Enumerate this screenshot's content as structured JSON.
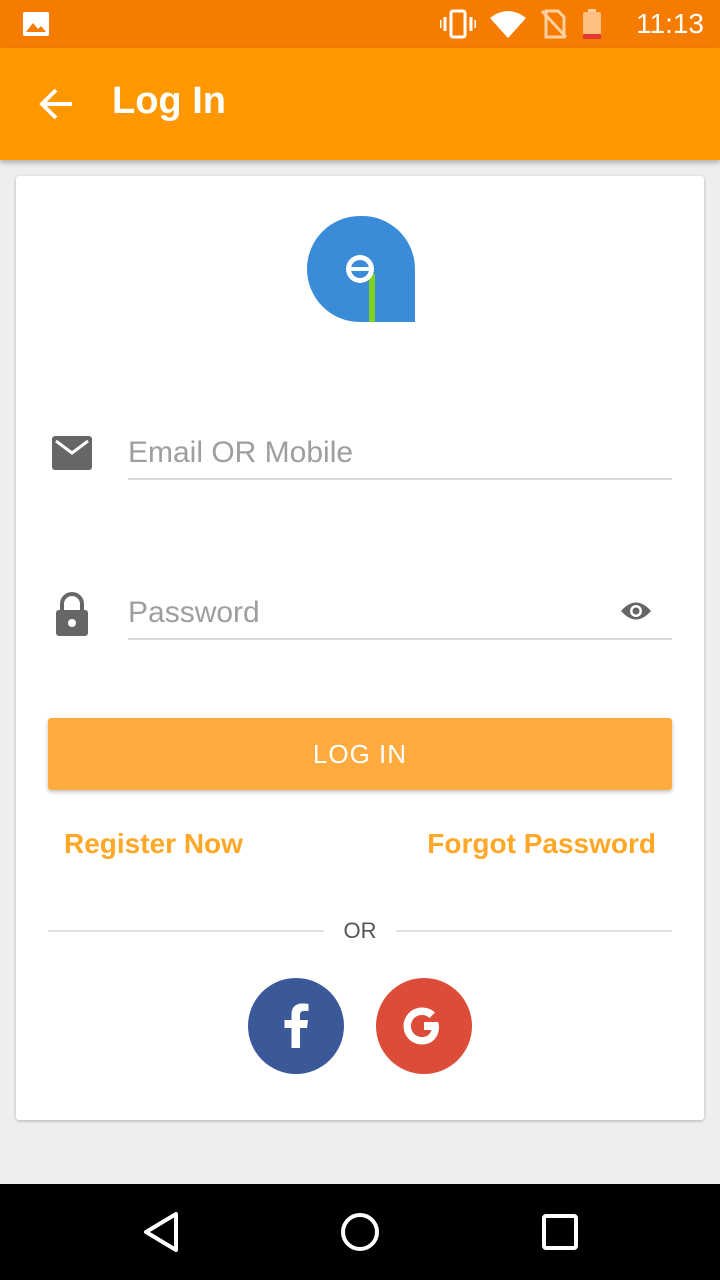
{
  "status_bar": {
    "time": "11:13",
    "icons": [
      "gallery-icon",
      "vibrate-icon",
      "wifi-icon",
      "no-sim-icon",
      "battery-low-icon"
    ]
  },
  "app_bar": {
    "title": "Log In",
    "back_icon": "arrow-left-icon",
    "color": "#ff9800"
  },
  "login_form": {
    "email_placeholder": "Email OR Mobile",
    "email_value": "",
    "password_placeholder": "Password",
    "password_value": "",
    "login_label": "LOG IN",
    "register_label": "Register Now",
    "forgot_label": "Forgot Password",
    "or_label": "OR"
  },
  "social": {
    "facebook_color": "#3b5998",
    "google_color": "#dd4b39"
  },
  "colors": {
    "accent": "#ffa726",
    "status_bar": "#f57c00",
    "login_button": "#ffab40"
  },
  "nav_bar": {
    "icons": [
      "back-triangle-icon",
      "home-circle-icon",
      "recents-square-icon"
    ]
  }
}
